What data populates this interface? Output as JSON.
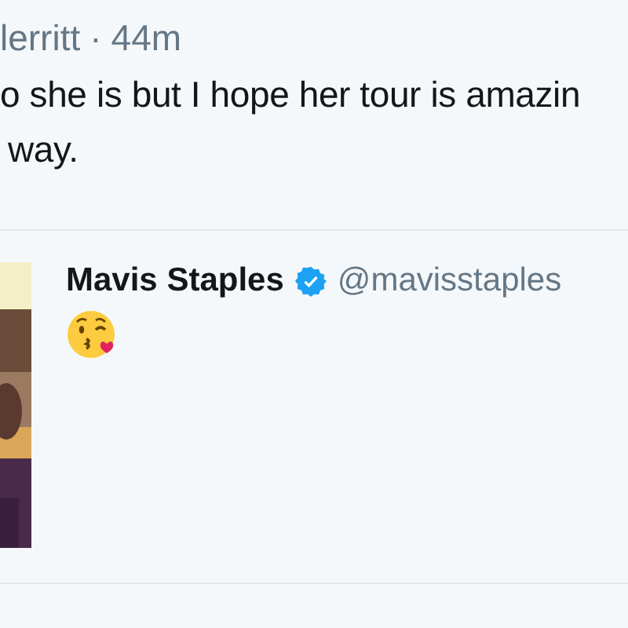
{
  "tweet": {
    "author_fragment": "lerritt",
    "separator": "·",
    "time": "44m",
    "text_lines": [
      "o she is but I hope her tour is amazin",
      "way."
    ]
  },
  "quoted_tweet": {
    "name": "Mavis Staples",
    "verified": true,
    "handle": "@mavisstaples"
  }
}
